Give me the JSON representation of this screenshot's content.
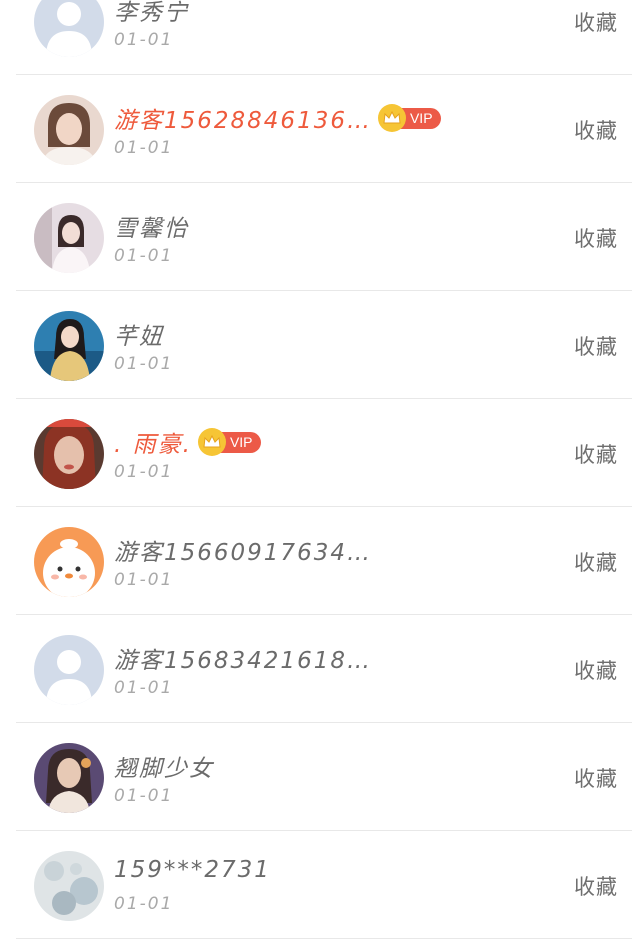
{
  "list": [
    {
      "name": "李秀宁",
      "date": "01-01",
      "action": "收藏",
      "vip": false,
      "avatar": "default-avatar-icon",
      "avatar_colors": [
        "#d2dbe9",
        "#ffffff"
      ]
    },
    {
      "name": "游客15628846136…",
      "date": "01-01",
      "action": "收藏",
      "vip": true,
      "vip_label": "VIP",
      "avatar": "user-photo-avatar",
      "avatar_colors": [
        "#e9d8cf",
        "#6b4a3a"
      ]
    },
    {
      "name": "雪馨怡",
      "date": "01-01",
      "action": "收藏",
      "vip": false,
      "avatar": "user-photo-avatar",
      "avatar_colors": [
        "#e6dde3",
        "#b7a6ad"
      ]
    },
    {
      "name": "芊妞",
      "date": "01-01",
      "action": "收藏",
      "vip": false,
      "avatar": "user-photo-avatar",
      "avatar_colors": [
        "#2e7fb1",
        "#e6c77a"
      ]
    },
    {
      "name": ". 雨豪.",
      "date": "01-01",
      "action": "收藏",
      "vip": true,
      "vip_label": "VIP",
      "avatar": "user-photo-avatar",
      "avatar_colors": [
        "#8c3324",
        "#e5c0ac"
      ]
    },
    {
      "name": "游客15660917634…",
      "date": "01-01",
      "action": "收藏",
      "vip": false,
      "avatar": "cartoon-chick-avatar",
      "avatar_colors": [
        "#f79a55",
        "#ffffff"
      ]
    },
    {
      "name": "游客15683421618…",
      "date": "01-01",
      "action": "收藏",
      "vip": false,
      "avatar": "default-avatar-icon",
      "avatar_colors": [
        "#d2dbe9",
        "#ffffff"
      ]
    },
    {
      "name": "翘脚少女",
      "date": "01-01",
      "action": "收藏",
      "vip": false,
      "avatar": "user-photo-avatar",
      "avatar_colors": [
        "#5a4a73",
        "#e7c9b5"
      ]
    },
    {
      "name": "159***2731",
      "date": "01-01",
      "action": "收藏",
      "vip": false,
      "avatar": "user-photo-avatar",
      "avatar_colors": [
        "#dfe4e6",
        "#a9b8c1"
      ]
    }
  ],
  "colors": {
    "vip_name": "#ee5a3c",
    "vip_tag": "#ec5a47",
    "vip_crown": "#f6c535",
    "text": "#6b6b6b",
    "date": "#a9a9a9",
    "divider": "#e8e8e8"
  }
}
